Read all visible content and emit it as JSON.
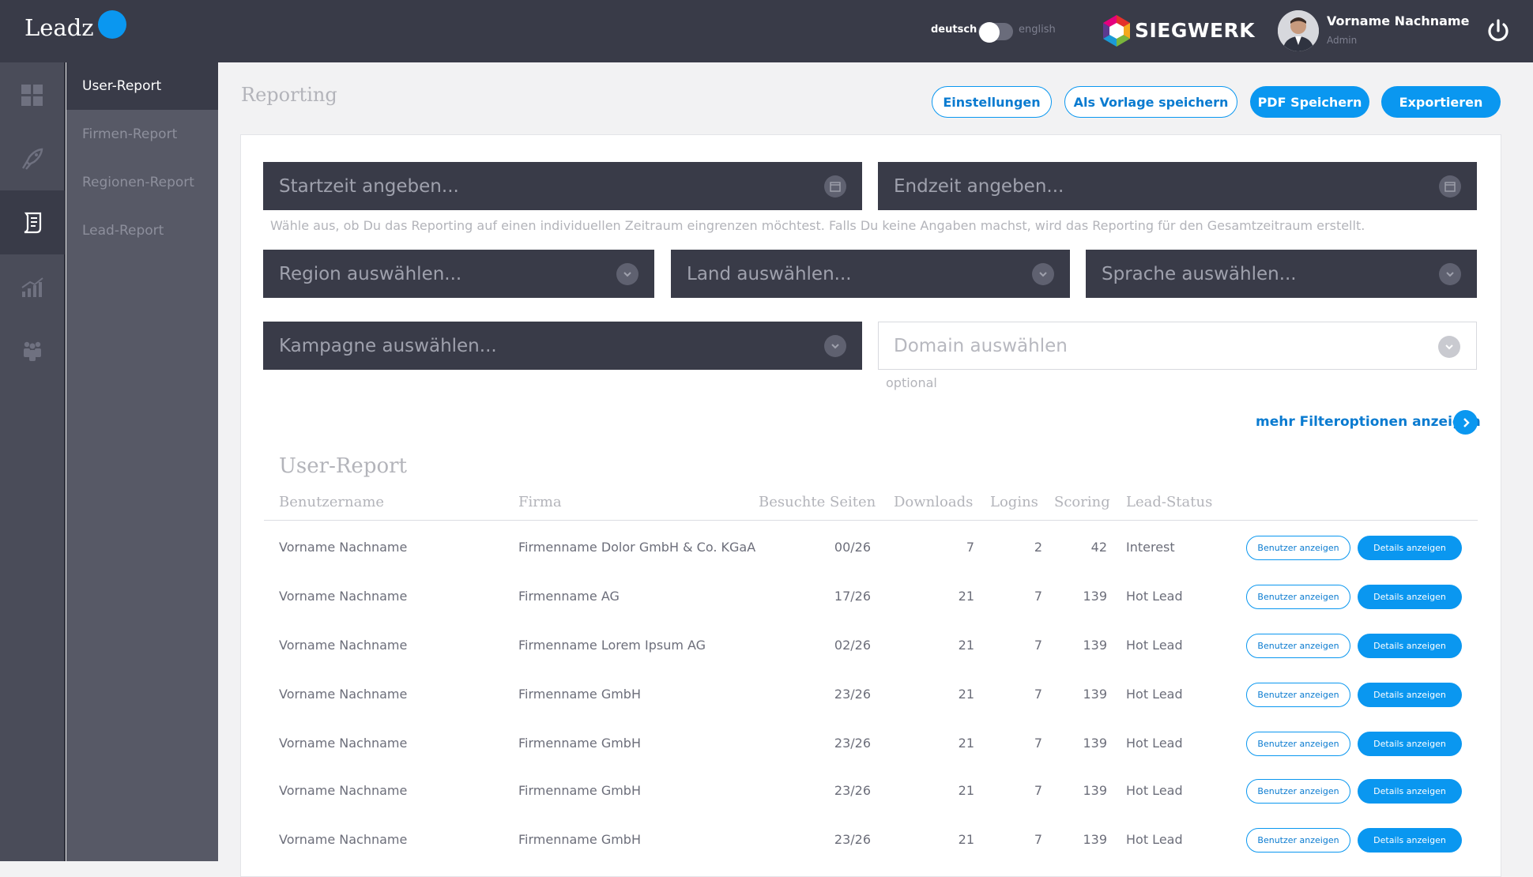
{
  "topbar": {
    "logo": "Leadz",
    "lang_de": "deutsch",
    "lang_en": "english",
    "brand": "SIEGWERK",
    "user_name": "Vorname Nachname",
    "user_role": "Admin"
  },
  "rail": {
    "items": [
      "dashboard-grid-icon",
      "rocket-icon",
      "report-icon",
      "chart-icon",
      "people-icon"
    ],
    "active_index": 2
  },
  "subnav": {
    "items": [
      {
        "label": "User-Report",
        "active": true
      },
      {
        "label": "Firmen-Report",
        "active": false
      },
      {
        "label": "Regionen-Report",
        "active": false
      },
      {
        "label": "Lead-Report",
        "active": false
      }
    ]
  },
  "page": {
    "title": "Reporting",
    "buttons": {
      "settings": "Einstellungen",
      "save_template": "Als Vorlage speichern",
      "pdf": "PDF Speichern",
      "export": "Exportieren"
    }
  },
  "filters": {
    "start": "Startzeit angeben...",
    "end": "Endzeit angeben...",
    "hint": "Wähle aus, ob Du das Reporting auf einen individuellen Zeitraum eingrenzen möchtest. Falls Du keine Angaben machst, wird das Reporting für den Gesamtzeitraum erstellt.",
    "region": "Region auswählen...",
    "country": "Land auswählen...",
    "language": "Sprache auswählen...",
    "campaign": "Kampagne auswählen...",
    "domain": "Domain auswählen",
    "optional": "optional",
    "more": "mehr Filteroptionen anzeigen"
  },
  "report": {
    "title": "User-Report",
    "columns": [
      "Benutzername",
      "Firma",
      "Besuchte Seiten",
      "Downloads",
      "Logins",
      "Scoring",
      "Lead-Status"
    ],
    "btn_user": "Benutzer anzeigen",
    "btn_details": "Details anzeigen",
    "rows": [
      [
        "Vorname Nachname",
        "Firmenname Dolor GmbH & Co. KGaA",
        "00/26",
        "7",
        "2",
        "42",
        "Interest"
      ],
      [
        "Vorname Nachname",
        "Firmenname AG",
        "17/26",
        "21",
        "7",
        "139",
        "Hot Lead"
      ],
      [
        "Vorname Nachname",
        "Firmenname Lorem Ipsum AG",
        "02/26",
        "21",
        "7",
        "139",
        "Hot Lead"
      ],
      [
        "Vorname Nachname",
        "Firmenname GmbH",
        "23/26",
        "21",
        "7",
        "139",
        "Hot Lead"
      ],
      [
        "Vorname Nachname",
        "Firmenname GmbH",
        "23/26",
        "21",
        "7",
        "139",
        "Hot Lead"
      ],
      [
        "Vorname Nachname",
        "Firmenname GmbH",
        "23/26",
        "21",
        "7",
        "139",
        "Hot Lead"
      ],
      [
        "Vorname Nachname",
        "Firmenname GmbH",
        "23/26",
        "21",
        "7",
        "139",
        "Hot Lead"
      ]
    ]
  },
  "colors": {
    "accent": "#0a97f0",
    "topbar": "#393b48",
    "field": "#393b48"
  }
}
